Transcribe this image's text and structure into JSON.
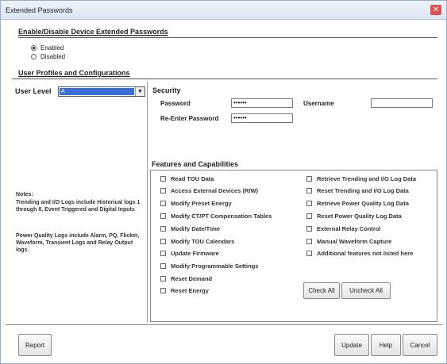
{
  "window": {
    "title": "Extended Passwords",
    "close_glyph": "✕"
  },
  "enable_section": {
    "title": "Enable/Disable Device Extended Passwords",
    "options": [
      {
        "label": "Enabled",
        "selected": true
      },
      {
        "label": "Disabled",
        "selected": false
      }
    ]
  },
  "profiles_section": {
    "title": "User Profiles and Configurations"
  },
  "user_level": {
    "label": "User Level",
    "value": "A",
    "arrow": "▼"
  },
  "security": {
    "title": "Security",
    "password_label": "Password",
    "password_value": "••••••",
    "reenter_label": "Re-Enter Password",
    "reenter_value": "••••••",
    "username_label": "Username",
    "username_value": ""
  },
  "notes": {
    "heading": "Notes:",
    "paragraph1": "Trending and I/O Logs include Historical logs 1 through 8, Event Triggered and Digital Inputs",
    "paragraph2": "Power Quality Logs include Alarm, PQ, Flicker, Waveform, Transient Logs and Relay Output logs."
  },
  "features": {
    "title": "Features and Capabilities",
    "left_items": [
      "Read TOU Data",
      "Access External Devices (R/W)",
      "Modify Preset Energy",
      "Modify CT/PT Compensation Tables",
      "Modify Date/Time",
      "Modify TOU Calendars",
      "Update Firmware",
      "Modify Programmable Settings",
      "Reset Demand",
      "Reset Energy"
    ],
    "right_items": [
      "Retrieve Trending and I/O Log Data",
      "Reset Trending and I/O Log Data",
      "Retrieve Power Quality Log Data",
      "Reset Power Quality Log Data",
      "External Relay Control",
      "Manual Waveform Capture",
      "Additional features not listed here"
    ],
    "check_all_label": "Check All",
    "uncheck_all_label": "Uncheck All"
  },
  "footer": {
    "report_label": "Report",
    "update_label": "Update",
    "help_label": "Help",
    "cancel_label": "Cancel"
  }
}
